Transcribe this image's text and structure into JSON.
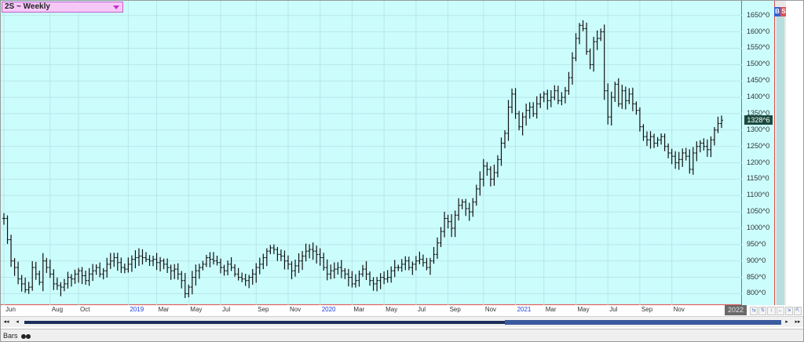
{
  "symbol": {
    "label": "2S ~ Weekly"
  },
  "indicator": {
    "b": "B",
    "s": "S"
  },
  "last_price_label": "1328^6",
  "year_box_label": "2022",
  "status": {
    "tab_label": "Bars"
  },
  "scroll": {
    "left_end": "◂◂",
    "left": "◂",
    "right": "▸",
    "right_end": "▸▸"
  },
  "period_buttons": [
    "⇆",
    "⇅",
    "↕",
    "↔",
    "⇲",
    "⇱"
  ],
  "chart_data": {
    "type": "ohlc",
    "title": "2S ~ Weekly",
    "ylim": [
      765,
      1695
    ],
    "yticks": [
      800,
      850,
      900,
      950,
      1000,
      1050,
      1100,
      1150,
      1200,
      1250,
      1300,
      1350,
      1400,
      1450,
      1500,
      1550,
      1600,
      1650
    ],
    "ytick_labels": [
      "800^0",
      "850^0",
      "900^0",
      "950^0",
      "1000^0",
      "1050^0",
      "1100^0",
      "1150^0",
      "1200^0",
      "1250^0",
      "1300^0",
      "1350^0",
      "1400^0",
      "1450^0",
      "1500^0",
      "1550^0",
      "1600^0",
      "1650^0"
    ],
    "xticks": [
      {
        "label": "Jun",
        "week": 0,
        "year": false
      },
      {
        "label": "Aug",
        "week": 13,
        "year": false
      },
      {
        "label": "Oct",
        "week": 21,
        "year": false
      },
      {
        "label": "2019",
        "week": 35,
        "year": true
      },
      {
        "label": "Mar",
        "week": 43,
        "year": false
      },
      {
        "label": "May",
        "week": 52,
        "year": false
      },
      {
        "label": "Jul",
        "week": 61,
        "year": false
      },
      {
        "label": "Sep",
        "week": 71,
        "year": false
      },
      {
        "label": "Nov",
        "week": 80,
        "year": false
      },
      {
        "label": "2020",
        "week": 89,
        "year": true
      },
      {
        "label": "Mar",
        "week": 98,
        "year": false
      },
      {
        "label": "May",
        "week": 107,
        "year": false
      },
      {
        "label": "Jul",
        "week": 116,
        "year": false
      },
      {
        "label": "Sep",
        "week": 125,
        "year": false
      },
      {
        "label": "Nov",
        "week": 135,
        "year": false
      },
      {
        "label": "2021",
        "week": 144,
        "year": true
      },
      {
        "label": "Mar",
        "week": 152,
        "year": false
      },
      {
        "label": "May",
        "week": 161,
        "year": false
      },
      {
        "label": "Jul",
        "week": 170,
        "year": false
      },
      {
        "label": "Sep",
        "week": 179,
        "year": false
      },
      {
        "label": "Nov",
        "week": 188,
        "year": false
      }
    ],
    "x_total_weeks": 202,
    "closes": [
      1030,
      965,
      900,
      880,
      845,
      830,
      812,
      820,
      880,
      860,
      835,
      900,
      880,
      860,
      830,
      825,
      820,
      830,
      850,
      845,
      860,
      870,
      855,
      840,
      860,
      870,
      880,
      860,
      870,
      890,
      900,
      910,
      895,
      880,
      875,
      890,
      905,
      910,
      915,
      910,
      905,
      900,
      905,
      895,
      900,
      890,
      880,
      870,
      875,
      860,
      840,
      800,
      820,
      850,
      870,
      880,
      890,
      910,
      905,
      900,
      895,
      880,
      870,
      890,
      880,
      860,
      850,
      845,
      840,
      850,
      860,
      880,
      890,
      910,
      930,
      940,
      935,
      920,
      915,
      900,
      890,
      870,
      885,
      900,
      915,
      930,
      935,
      930,
      920,
      910,
      880,
      860,
      870,
      875,
      880,
      870,
      860,
      850,
      830,
      840,
      860,
      875,
      860,
      840,
      830,
      840,
      850,
      845,
      850,
      870,
      880,
      880,
      890,
      900,
      880,
      890,
      900,
      905,
      895,
      880,
      900,
      920,
      955,
      990,
      1030,
      1020,
      1000,
      1040,
      1070,
      1080,
      1060,
      1050,
      1080,
      1120,
      1150,
      1190,
      1180,
      1150,
      1170,
      1210,
      1260,
      1290,
      1370,
      1410,
      1350,
      1310,
      1340,
      1360,
      1370,
      1350,
      1380,
      1400,
      1410,
      1390,
      1400,
      1420,
      1390,
      1400,
      1420,
      1460,
      1520,
      1580,
      1620,
      1610,
      1540,
      1500,
      1570,
      1580,
      1600,
      1420,
      1340,
      1400,
      1440,
      1380,
      1420,
      1390,
      1410,
      1380,
      1360,
      1310,
      1280,
      1270,
      1280,
      1260,
      1270,
      1280,
      1250,
      1230,
      1220,
      1200,
      1210,
      1230,
      1220,
      1180,
      1230,
      1250,
      1260,
      1250,
      1240,
      1270,
      1300,
      1320,
      1330
    ],
    "highs_offset": 18,
    "lows_offset": 20
  }
}
